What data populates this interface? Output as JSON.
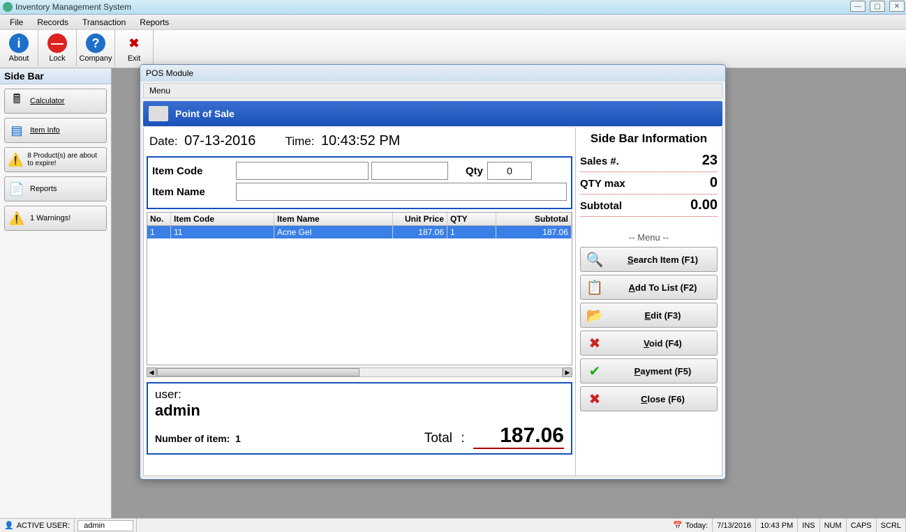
{
  "window": {
    "title": "Inventory Management System"
  },
  "menubar": [
    "File",
    "Records",
    "Transaction",
    "Reports"
  ],
  "toolbar": {
    "about": "About",
    "lock": "Lock",
    "company": "Company",
    "exit": "Exit"
  },
  "sidebar": {
    "title": "Side Bar",
    "items": [
      {
        "label": "Calculator"
      },
      {
        "label": "Item Info"
      },
      {
        "label": "8 Product(s) are about to expire!"
      },
      {
        "label": "Reports"
      },
      {
        "label": "1 Warnings!"
      }
    ]
  },
  "pos": {
    "title": "POS Module",
    "menu": "Menu",
    "header": "Point of Sale",
    "date_label": "Date:",
    "date_value": "07-13-2016",
    "time_label": "Time:",
    "time_value": "10:43:52 PM",
    "item_code_label": "Item Code",
    "item_code_value": "",
    "item_extra_value": "",
    "qty_label": "Qty",
    "qty_value": "0",
    "item_name_label": "Item Name",
    "item_name_value": "",
    "grid": {
      "headers": {
        "no": "No.",
        "code": "Item Code",
        "name": "Item Name",
        "price": "Unit Price",
        "qty": "QTY",
        "sub": "Subtotal"
      },
      "rows": [
        {
          "no": "1",
          "code": "11",
          "name": "Acne Gel",
          "price": "187.06",
          "qty": "1",
          "sub": "187.06"
        }
      ]
    },
    "summary": {
      "user_label": "user:",
      "user_value": "admin",
      "count_label": "Number of item:",
      "count_value": "1",
      "total_label": "Total",
      "total_value": "187.06"
    },
    "sidebar_info": {
      "title": "Side Bar Information",
      "sales_label": "Sales #.",
      "sales_value": "23",
      "qtymax_label": "QTY max",
      "qtymax_value": "0",
      "subtotal_label": "Subtotal",
      "subtotal_value": "0.00",
      "menu_label": "-- Menu --",
      "actions": {
        "search": "Search Item (F1)",
        "add": "Add To List (F2)",
        "edit": "Edit (F3)",
        "void": "Void (F4)",
        "payment": "Payment (F5)",
        "close": "Close (F6)"
      }
    }
  },
  "statusbar": {
    "active_user_label": "ACTIVE USER:",
    "active_user": "admin",
    "today_label": "Today:",
    "today_date": "7/13/2016",
    "today_time": "10:43 PM",
    "ins": "INS",
    "num": "NUM",
    "caps": "CAPS",
    "scrl": "SCRL"
  }
}
